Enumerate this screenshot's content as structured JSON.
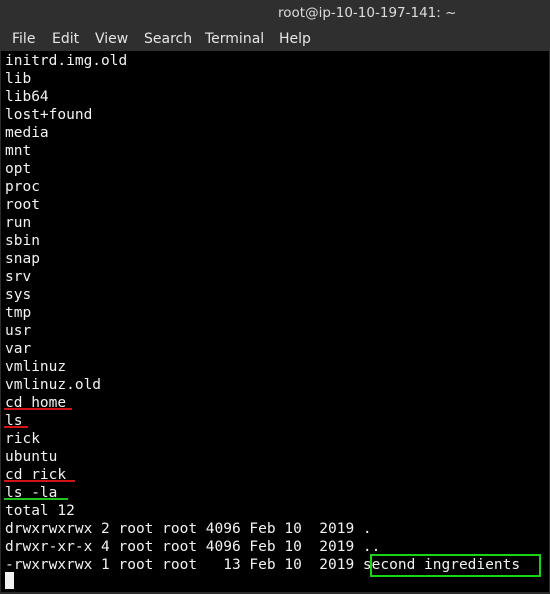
{
  "window": {
    "title": "root@ip-10-10-197-141: ~"
  },
  "menu": {
    "items": [
      "File",
      "Edit",
      "View",
      "Search",
      "Terminal",
      "Help"
    ]
  },
  "terminal": {
    "lines": [
      "initrd.img.old",
      "lib",
      "lib64",
      "lost+found",
      "media",
      "mnt",
      "opt",
      "proc",
      "root",
      "run",
      "sbin",
      "snap",
      "srv",
      "sys",
      "tmp",
      "usr",
      "var",
      "vmlinuz",
      "vmlinuz.old",
      "cd home",
      "ls",
      "rick",
      "ubuntu",
      "cd rick",
      "ls -la",
      "total 12",
      "drwxrwxrwx 2 root root 4096 Feb 10  2019 .",
      "drwxr-xr-x 4 root root 4096 Feb 10  2019 ..",
      "-rwxrwxrwx 1 root root   13 Feb 10  2019 second ingredients"
    ]
  },
  "annotations": {
    "red_underline_color": "#d41414",
    "green_underline_color": "#1fc41f",
    "highlight_box_color": "#18d418"
  }
}
